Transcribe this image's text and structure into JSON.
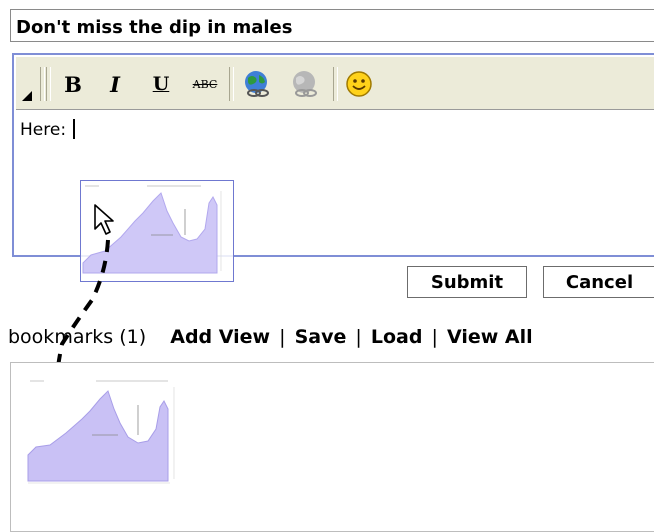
{
  "title_field": {
    "value": "Don't miss the dip in males"
  },
  "toolbar": {
    "bold_label": "B",
    "italic_label": "I",
    "underline_label": "U",
    "strike_label": "ABC",
    "link_icon": "globe-link-icon",
    "unlink_icon": "globe-unlink-icon",
    "smiley_icon": "smiley-icon"
  },
  "editor": {
    "text": "Here: "
  },
  "buttons": {
    "submit": "Submit",
    "cancel": "Cancel"
  },
  "bookmarks": {
    "label": "bookmarks (1)",
    "add_view": "Add View",
    "save": "Save",
    "load": "Load",
    "view_all": "View All",
    "separator": "|"
  },
  "colors": {
    "accent": "#7f8ed6",
    "chart_fill": "#c9c3f5",
    "chart_line": "#a89ee8",
    "toolbar_bg": "#ecebd9"
  }
}
